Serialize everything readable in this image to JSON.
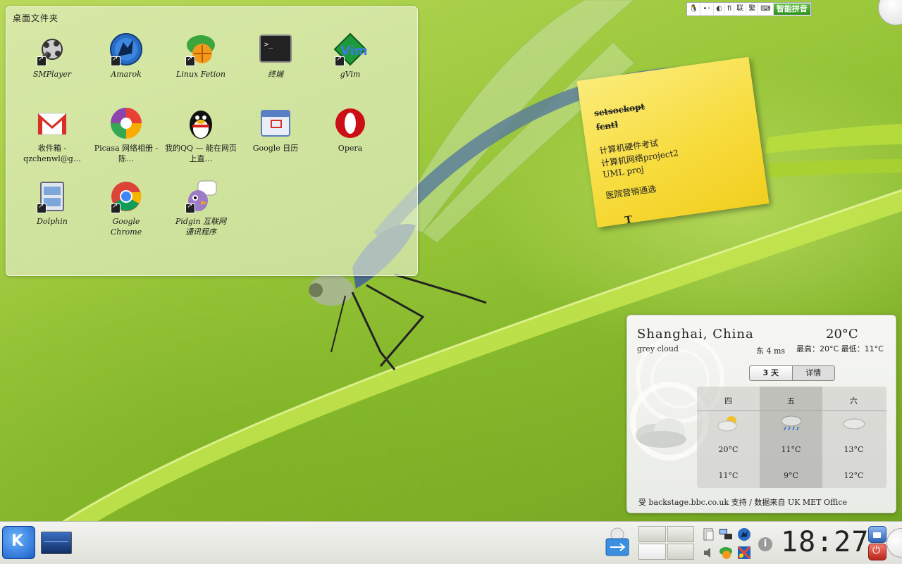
{
  "folder_view": {
    "title": "桌面文件夹",
    "items": [
      {
        "label": "SMPlayer",
        "icon": "smplayer-icon"
      },
      {
        "label": "Amarok",
        "icon": "amarok-wolf-icon"
      },
      {
        "label": "Linux Fetion",
        "icon": "fetion-icon"
      },
      {
        "label": "终端",
        "icon": "terminal-icon"
      },
      {
        "label": "gVim",
        "icon": "gvim-icon"
      },
      {
        "label": "收件箱 - qzchenwl@g…",
        "icon": "gmail-icon"
      },
      {
        "label": "Picasa 网络相册 - 陈…",
        "icon": "picasa-icon"
      },
      {
        "label": "我的QQ — 能在网页上直…",
        "icon": "qq-penguin-icon"
      },
      {
        "label": "Google 日历",
        "icon": "google-calendar-icon"
      },
      {
        "label": "Opera",
        "icon": "opera-icon"
      },
      {
        "label": "Dolphin",
        "icon": "dolphin-file-manager-icon"
      },
      {
        "label": "Google Chrome",
        "icon": "chrome-icon"
      },
      {
        "label": "Pidgin 互联网通讯程序",
        "icon": "pidgin-icon"
      }
    ]
  },
  "note": {
    "struck_lines": [
      "setsockopt",
      "fcntl"
    ],
    "lines": [
      "计算机硬件考试",
      "计算机网络project2",
      "UML proj",
      "医院营销通选"
    ]
  },
  "weather": {
    "city": "Shanghai, China",
    "temperature": "20°C",
    "condition": "grey cloud",
    "wind": "东 4 ms",
    "high_low": "最高：20°C 最低：11°C",
    "tabs": [
      "3 天",
      "详情"
    ],
    "forecast": [
      {
        "day": "四",
        "icon": "partly-cloudy-icon",
        "high": "20°C",
        "low": "11°C"
      },
      {
        "day": "五",
        "icon": "rain-icon",
        "high": "11°C",
        "low": "9°C"
      },
      {
        "day": "六",
        "icon": "cloudy-icon",
        "high": "13°C",
        "low": "12°C"
      }
    ],
    "footer": "受 backstage.bbc.co.uk 支持 / 数据来自 UK MET Office"
  },
  "ime_toolbar": {
    "items": [
      "🐧",
      "•◦",
      "◐",
      "fi",
      "联",
      "繁",
      "⌨"
    ],
    "brand": "智能拼音"
  },
  "panel": {
    "clock": "18:27",
    "colors": {
      "kmenu": "#1b5fc8",
      "leave": "#b8261b"
    }
  }
}
